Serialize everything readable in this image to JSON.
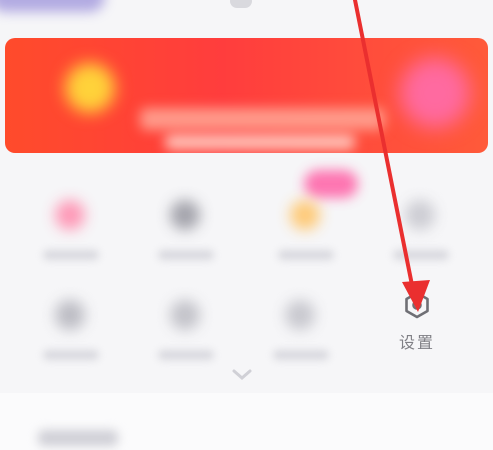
{
  "settings": {
    "label": "设置",
    "icon": "settings-hex-gear-icon"
  },
  "annotation": {
    "arrow_color": "#ea2f2f",
    "points_to": "settings"
  },
  "banner": {
    "colors": [
      "#ff4b2b",
      "#ff3d3d",
      "#ff5a3a"
    ]
  }
}
